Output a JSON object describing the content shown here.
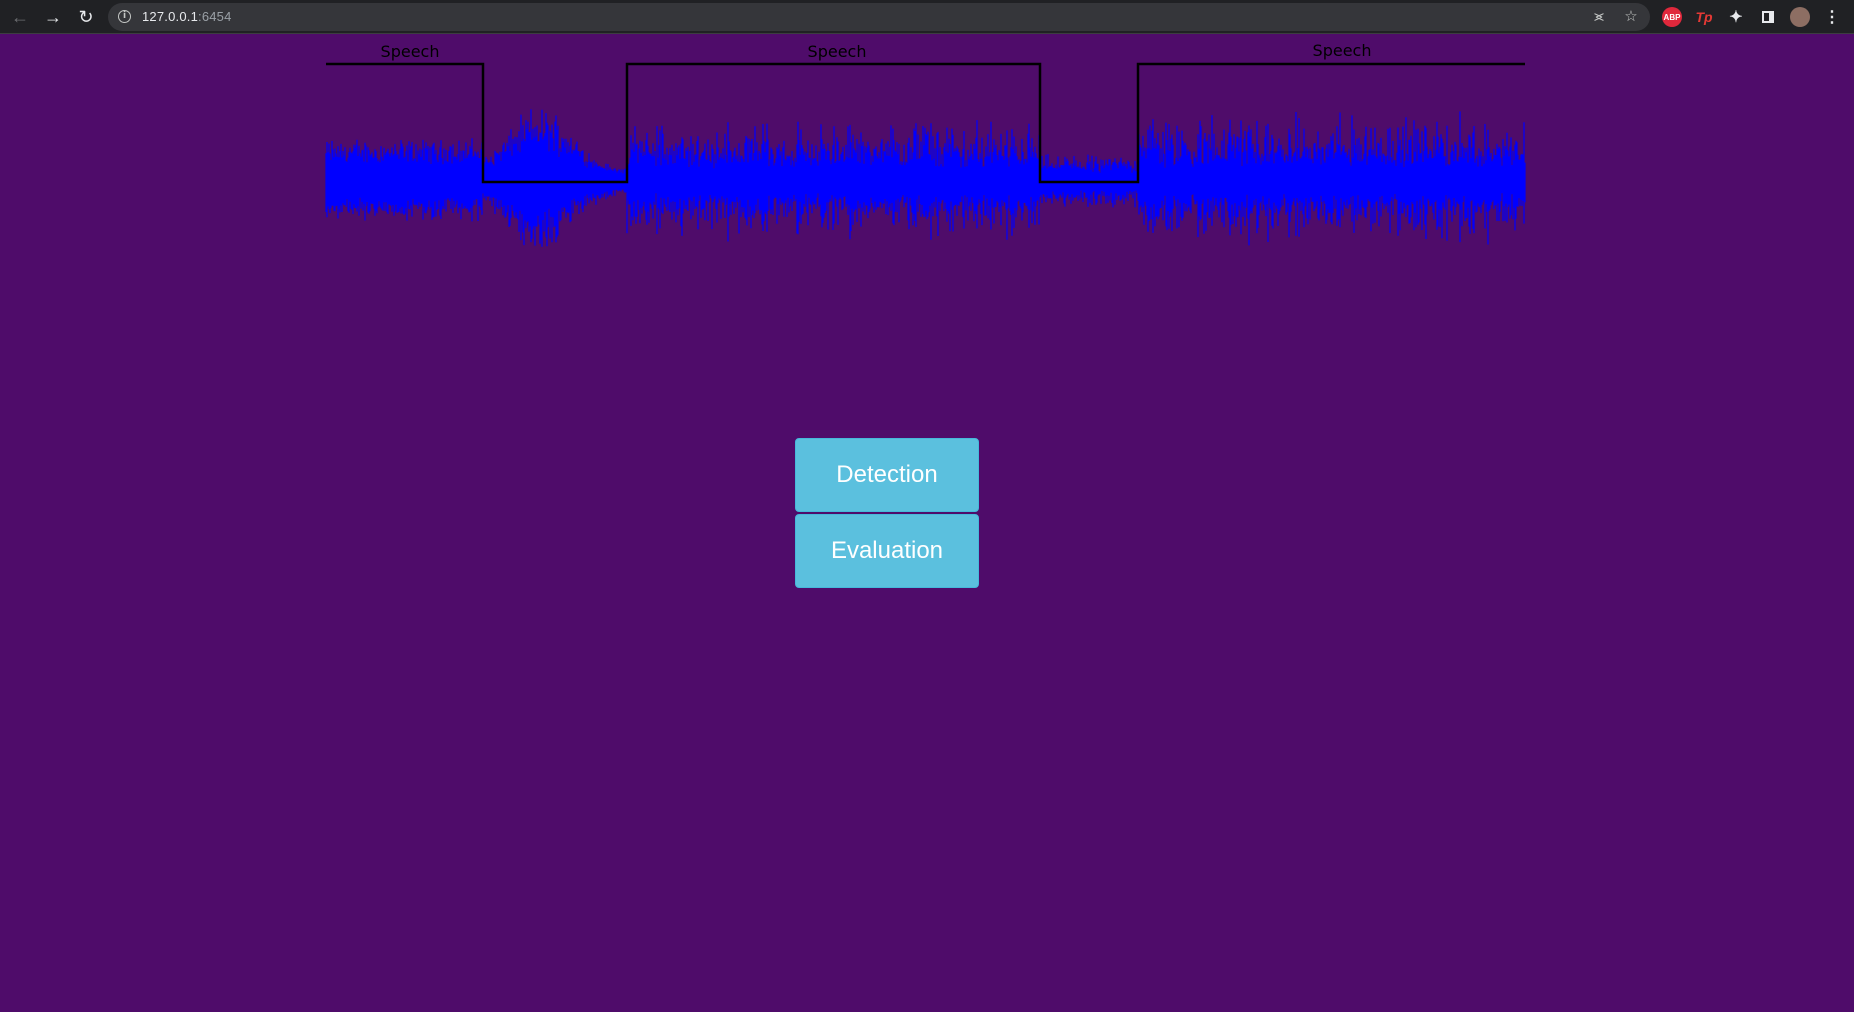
{
  "browser": {
    "url_host": "127.0.0.1",
    "url_port": ":6454",
    "ext_abp": "ABP",
    "ext_tp": "Tp"
  },
  "waveform": {
    "segment_labels": [
      "Speech",
      "Speech",
      "Speech"
    ],
    "wave_color": "#0000ff",
    "segment_line_color": "#000000"
  },
  "buttons": {
    "detection": "Detection",
    "evaluation": "Evaluation"
  },
  "colors": {
    "background": "#4f0c6a",
    "button": "#5bc0de"
  }
}
